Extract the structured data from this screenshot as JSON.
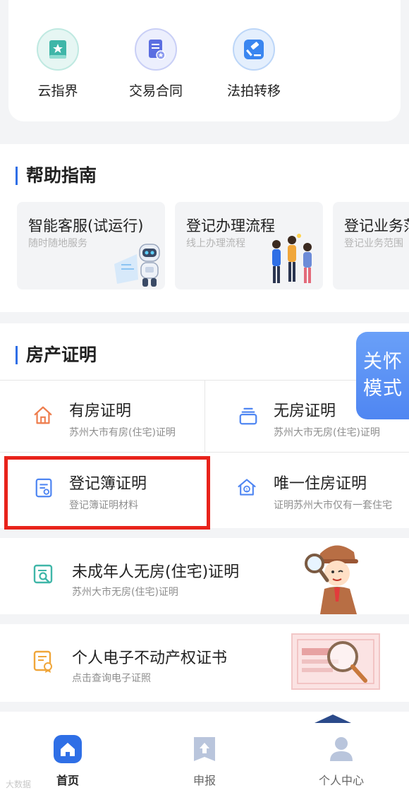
{
  "quick_access": [
    {
      "label": "云指界",
      "icon": "book-star-icon",
      "color": "#3fb6a8"
    },
    {
      "label": "交易合同",
      "icon": "contract-icon",
      "color": "#5b6ee1"
    },
    {
      "label": "法拍转移",
      "icon": "gavel-icon",
      "color": "#3a86f0"
    }
  ],
  "help": {
    "title": "帮助指南",
    "cards": [
      {
        "title": "智能客服(试运行)",
        "sub": "随时随地服务",
        "icon": "robot-icon"
      },
      {
        "title": "登记办理流程",
        "sub": "线上办理流程",
        "icon": "people-icon"
      },
      {
        "title": "登记业务范",
        "sub": "登记业务范围",
        "icon": "doc-icon"
      }
    ]
  },
  "property": {
    "title": "房产证明",
    "items": [
      {
        "title": "有房证明",
        "sub": "苏州大市有房(住宅)证明",
        "icon": "house-icon"
      },
      {
        "title": "无房证明",
        "sub": "苏州大市无房(住宅)证明",
        "icon": "stack-icon"
      },
      {
        "title": "登记簿证明",
        "sub": "登记簿证明材料",
        "icon": "register-book-icon"
      },
      {
        "title": "唯一住房证明",
        "sub": "证明苏州大市仅有一套住宅",
        "icon": "unique-house-icon"
      }
    ]
  },
  "care_mode": {
    "line1": "关怀",
    "line2": "模式"
  },
  "banners": [
    {
      "title": "未成年人无房(住宅)证明",
      "sub": "苏州大市无房(住宅)证明",
      "icon": "search-doc-icon"
    },
    {
      "title": "个人电子不动产权证书",
      "sub": "点击查询电子证照",
      "icon": "certificate-icon"
    }
  ],
  "nav": [
    {
      "label": "首页",
      "icon": "home-icon",
      "active": true
    },
    {
      "label": "申报",
      "icon": "upload-icon",
      "active": false
    },
    {
      "label": "个人中心",
      "icon": "user-icon",
      "active": false
    }
  ],
  "watermark": "大数据"
}
